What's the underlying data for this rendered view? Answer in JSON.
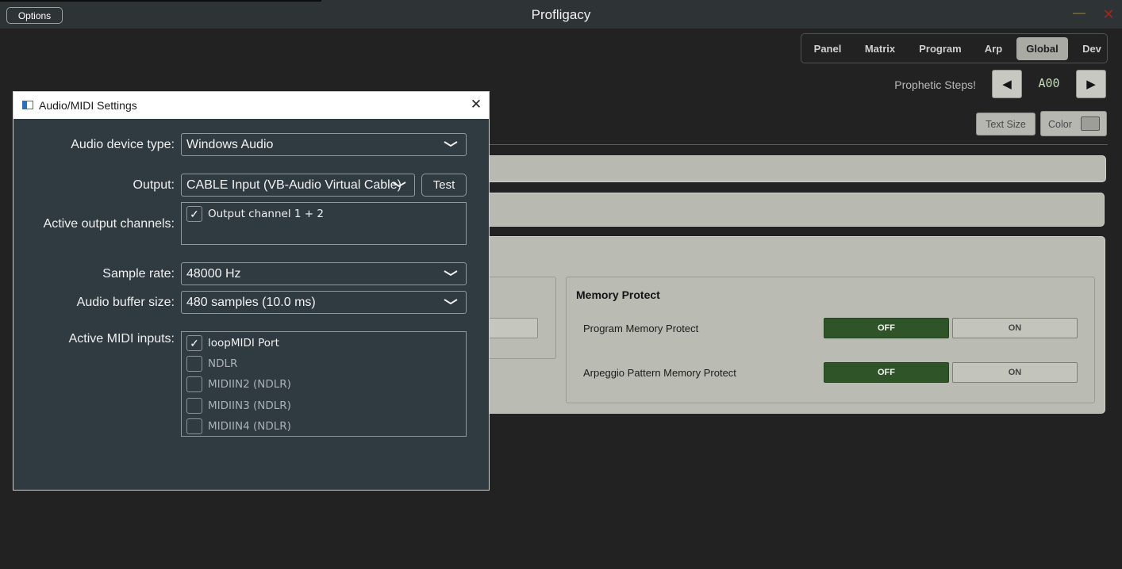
{
  "app": {
    "title": "Profligacy",
    "options_label": "Options",
    "minimize_glyph": "—",
    "close_glyph": "✕"
  },
  "tabs": [
    {
      "label": "Panel",
      "active": false
    },
    {
      "label": "Matrix",
      "active": false
    },
    {
      "label": "Program",
      "active": false
    },
    {
      "label": "Arp",
      "active": false
    },
    {
      "label": "Global",
      "active": true
    },
    {
      "label": "Dev",
      "active": false
    }
  ],
  "header": {
    "prophetic_label": "Prophetic Steps!",
    "prev_glyph": "◀",
    "next_glyph": "▶",
    "patch_number": "A00",
    "text_size_label": "Text Size",
    "color_label": "Color"
  },
  "memory_protect": {
    "title": "Memory Protect",
    "rows": [
      {
        "label": "Program Memory Protect",
        "off_label": "OFF",
        "on_label": "ON",
        "selected": "OFF"
      },
      {
        "label": "Arpeggio Pattern Memory Protect",
        "off_label": "OFF",
        "on_label": "ON",
        "selected": "OFF"
      }
    ]
  },
  "dialog": {
    "title": "Audio/MIDI Settings",
    "close_glyph": "✕",
    "device_type": {
      "label": "Audio device type:",
      "value": "Windows Audio"
    },
    "output": {
      "label": "Output:",
      "value": "CABLE Input (VB-Audio Virtual Cable)",
      "test_label": "Test"
    },
    "output_channels": {
      "label": "Active output channels:",
      "items": [
        {
          "label": "Output channel 1 + 2",
          "checked": true
        }
      ]
    },
    "sample_rate": {
      "label": "Sample rate:",
      "value": "48000 Hz"
    },
    "buffer_size": {
      "label": "Audio buffer size:",
      "value": "480 samples (10.0 ms)"
    },
    "midi_inputs": {
      "label": "Active MIDI inputs:",
      "items": [
        {
          "label": "loopMIDI Port",
          "checked": true
        },
        {
          "label": "NDLR",
          "checked": false
        },
        {
          "label": "MIDIIN2 (NDLR)",
          "checked": false
        },
        {
          "label": "MIDIIN3 (NDLR)",
          "checked": false
        },
        {
          "label": "MIDIIN4 (NDLR)",
          "checked": false
        }
      ]
    },
    "check_glyph": "✓"
  },
  "colors": {
    "toggle_selected": "#2f5428",
    "tab_active": "#a8aaa3",
    "dialog_bg": "#303b41",
    "patch_number": "#c6ddb5"
  }
}
